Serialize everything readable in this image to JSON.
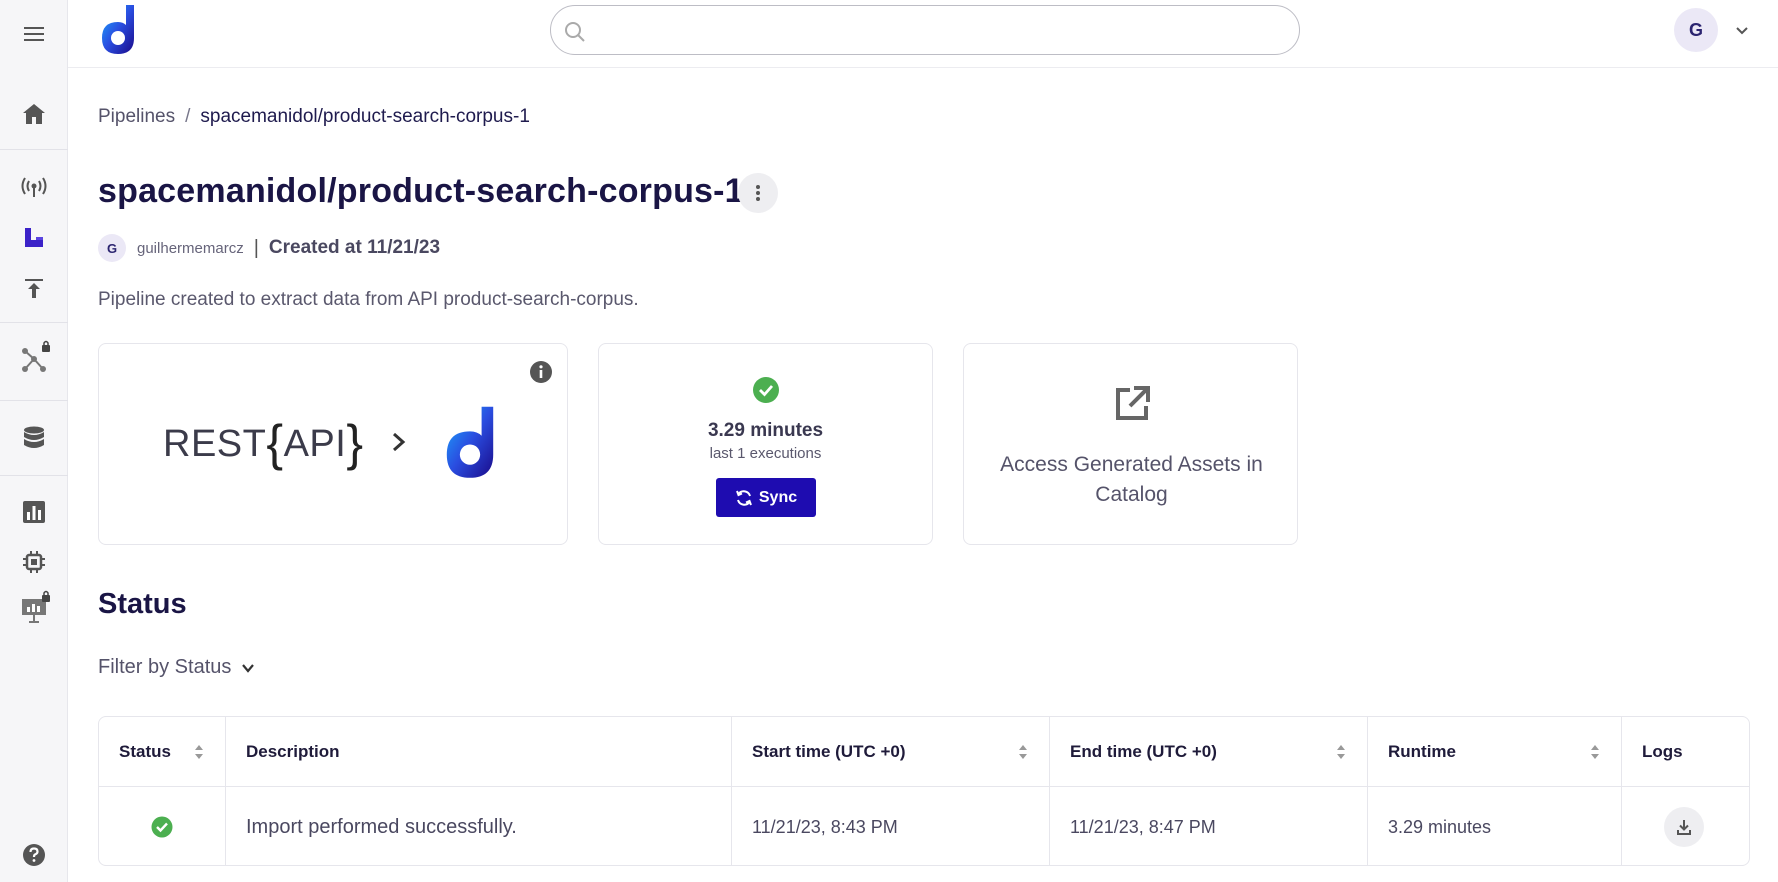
{
  "header": {
    "search": {
      "placeholder": "",
      "value": ""
    },
    "user_initial": "G"
  },
  "breadcrumb": {
    "root": "Pipelines",
    "separator": "/",
    "current": "spacemanidol/product-search-corpus-1"
  },
  "pipeline": {
    "title": "spacemanidol/product-search-corpus-1",
    "owner_initial": "G",
    "owner": "guilhermemarcz",
    "meta_separator": "|",
    "created": "Created at 11/21/23",
    "description": "Pipeline created to extract data from API product-search-corpus."
  },
  "source_card": {
    "rest_prefix": "REST",
    "brace_open": "{",
    "rest_api": "API",
    "brace_close": "}",
    "icons": [
      "info-icon",
      "chevron-right-icon",
      "destination-logo"
    ]
  },
  "runtime_card": {
    "value": "3.29 minutes",
    "sub": "last 1 executions",
    "sync_label": "Sync"
  },
  "catalog_card": {
    "label": "Access Generated Assets in Catalog"
  },
  "status_section": {
    "title": "Status",
    "filter_label": "Filter by Status"
  },
  "table": {
    "columns": [
      "Status",
      "Description",
      "Start time (UTC +0)",
      "End time (UTC +0)",
      "Runtime",
      "Logs"
    ],
    "rows": [
      {
        "status": "success",
        "description": "Import performed successfully.",
        "start": "11/21/23, 8:43 PM",
        "end": "11/21/23, 8:47 PM",
        "runtime": "3.29 minutes"
      }
    ]
  },
  "colors": {
    "accent": "#1e0cb0",
    "success": "#4caf50",
    "title": "#1a1545"
  },
  "sidebar_icons": [
    "menu-icon",
    "home-icon",
    "broadcast-icon",
    "pipeline-icon",
    "upload-icon",
    "graph-locked-icon",
    "database-icon",
    "chart-icon",
    "chip-icon",
    "presentation-locked-icon",
    "help-icon"
  ]
}
